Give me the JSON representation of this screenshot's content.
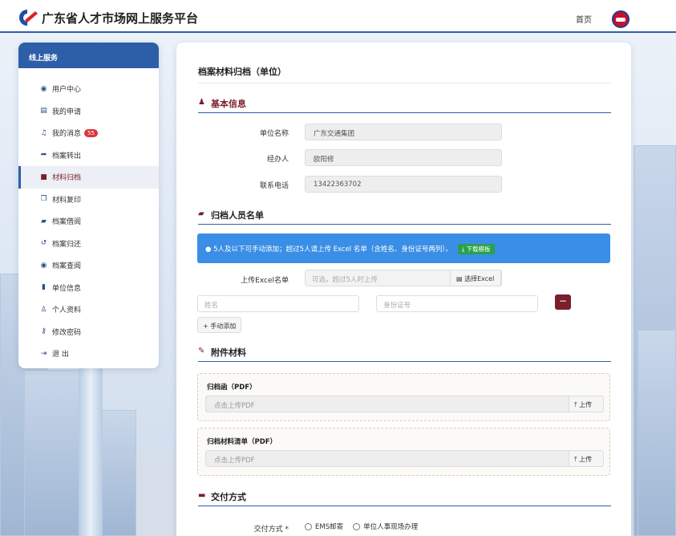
{
  "header": {
    "site_title": "广东省人才市场网上服务平台",
    "nav_home": "首页"
  },
  "sidebar": {
    "heading": "线上服务",
    "items": [
      {
        "label": "用户中心",
        "icon": "user-circle-icon"
      },
      {
        "label": "我的申请",
        "icon": "document-icon"
      },
      {
        "label": "我的消息",
        "icon": "bell-icon",
        "badge": "55"
      },
      {
        "label": "档案转出",
        "icon": "share-arrow-icon"
      },
      {
        "label": "材料归档",
        "icon": "folder-icon",
        "active": true
      },
      {
        "label": "材料复印",
        "icon": "copy-icon"
      },
      {
        "label": "档案借阅",
        "icon": "book-icon"
      },
      {
        "label": "档案归还",
        "icon": "undo-icon"
      },
      {
        "label": "档案查阅",
        "icon": "eye-icon"
      },
      {
        "label": "单位信息",
        "icon": "building-icon"
      },
      {
        "label": "个人资料",
        "icon": "person-icon"
      },
      {
        "label": "修改密码",
        "icon": "key-icon"
      },
      {
        "label": "退 出",
        "icon": "logout-icon"
      }
    ]
  },
  "main": {
    "page_title": "档案材料归档（单位）",
    "basic": {
      "title": "基本信息",
      "unit_label": "单位名称",
      "unit_value": "广东交通集团",
      "handler_label": "经办人",
      "handler_value": "欧阳修",
      "phone_label": "联系电话",
      "phone_value": "13422363702"
    },
    "persons": {
      "title": "归档人员名单",
      "notice": "5人及以下可手动添加；超过5人请上传 Excel 名单（含姓名、身份证号两列）。",
      "download_label": "下载模板",
      "excel_label": "上传Excel名单",
      "excel_placeholder": "可选，超过5人时上传",
      "choose_excel_label": "选择Excel",
      "name_placeholder": "姓名",
      "id_placeholder": "身份证号",
      "remove_label": "−",
      "add_label": "+ 手动添加"
    },
    "attachments": {
      "title": "附件材料",
      "files": [
        {
          "title": "归档函（PDF）",
          "placeholder": "点击上传PDF",
          "button": "上传"
        },
        {
          "title": "归档材料清单（PDF）",
          "placeholder": "点击上传PDF",
          "button": "上传"
        }
      ]
    },
    "delivery": {
      "title": "交付方式",
      "label": "交付方式 *",
      "options": [
        "EMS邮寄",
        "单位人事现场办理"
      ]
    }
  },
  "colors": {
    "brand_blue": "#2d5fa8",
    "accent_maroon": "#7a1f2b",
    "notice_blue": "#3a8ee6",
    "download_green": "#2aa14b",
    "badge_red": "#d9363e"
  }
}
